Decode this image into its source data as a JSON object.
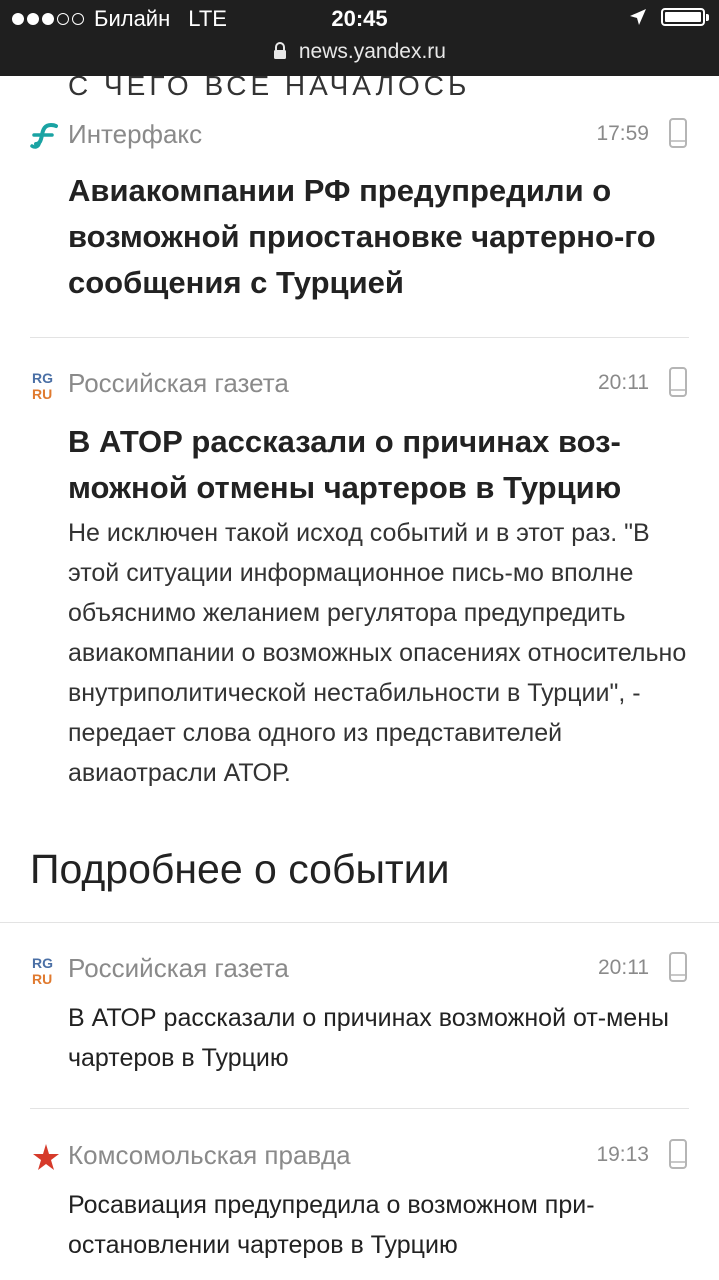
{
  "status": {
    "carrier": "Билайн",
    "network": "LTE",
    "time": "20:45",
    "url": "news.yandex.ru"
  },
  "section_title": "С ЧЕГО ВСЕ НАЧАЛОСЬ",
  "stories": [
    {
      "source": "Интерфакс",
      "time": "17:59",
      "logo": "interfax-logo",
      "headline": "Авиакомпании РФ предупредили о возможной приостановке чартерно-го сообщения с Турцией"
    },
    {
      "source": "Российская газета",
      "time": "20:11",
      "logo": "rg-logo",
      "headline": "В АТОР рассказали о причинах воз-можной отмены чартеров в Турцию",
      "text": "Не исключен такой исход событий и в этот раз. \"В этой ситуации информационное пись-мо вполне объяснимо желанием регулятора предупредить авиакомпании о возможных опасениях относительно внутриполитической нестабильности в Турции\", - передает слова одного из представителей авиаотрасли АТОР."
    }
  ],
  "more_title": "Подробнее о событии",
  "more_items": [
    {
      "source": "Российская газета",
      "time": "20:11",
      "logo": "rg-logo",
      "title": "В АТОР рассказали о причинах возможной от-мены чартеров в Турцию"
    },
    {
      "source": "Комсомольская правда",
      "time": "19:13",
      "logo": "kp-logo",
      "title": "Росавиация предупредила о возможном при-остановлении чартеров в Турцию"
    }
  ],
  "colors": {
    "status_bg": "#1f1f1f",
    "source_gray": "#8a8a8a",
    "interfax_teal": "#1aa3a3",
    "rg_blue": "#4a6fa5",
    "rg_orange": "#e07a2f",
    "kp_red": "#d63a2a"
  }
}
